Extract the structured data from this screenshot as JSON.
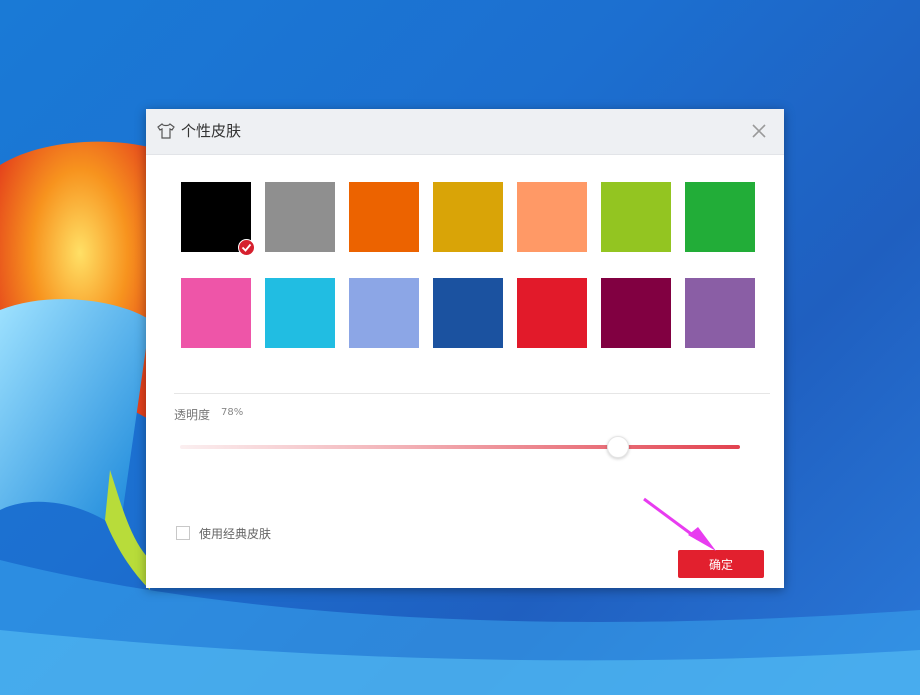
{
  "dialog": {
    "title": "个性皮肤",
    "title_icon": "tshirt-icon",
    "close_icon": "close-icon"
  },
  "swatches": [
    {
      "color": "#000000",
      "selected": true
    },
    {
      "color": "#8f8f8f",
      "selected": false
    },
    {
      "color": "#ec6300",
      "selected": false
    },
    {
      "color": "#d9a407",
      "selected": false
    },
    {
      "color": "#ff9966",
      "selected": false
    },
    {
      "color": "#93c521",
      "selected": false
    },
    {
      "color": "#22ad38",
      "selected": false
    },
    {
      "color": "#ee55a8",
      "selected": false
    },
    {
      "color": "#21bde2",
      "selected": false
    },
    {
      "color": "#8ca6e6",
      "selected": false
    },
    {
      "color": "#1b52a0",
      "selected": false
    },
    {
      "color": "#e21a2a",
      "selected": false
    },
    {
      "color": "#810041",
      "selected": false
    },
    {
      "color": "#8a5ea5",
      "selected": false
    }
  ],
  "opacity": {
    "label": "透明度",
    "value_text": "78%",
    "value": 0.78
  },
  "classic_skin": {
    "label": "使用经典皮肤",
    "checked": false
  },
  "ok_button": {
    "label": "确定"
  },
  "colors": {
    "accent": "#e2202e",
    "arrow": "#e83cf0"
  }
}
